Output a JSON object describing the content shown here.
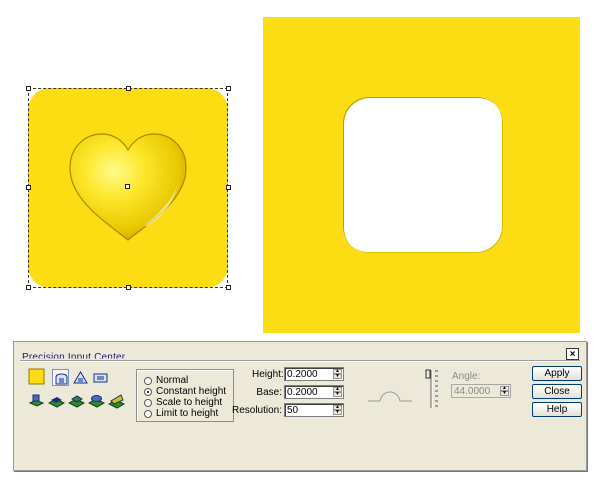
{
  "dialog": {
    "title": "Precision Input Center",
    "close_glyph": "×",
    "color_swatch": "#fcdc12",
    "modes": [
      {
        "label": "Normal",
        "selected": false
      },
      {
        "label": "Constant height",
        "selected": true
      },
      {
        "label": "Scale to height",
        "selected": false
      },
      {
        "label": "Limit to height",
        "selected": false
      }
    ],
    "height_label": "Height:",
    "height_value": "0.2000",
    "base_label": "Base:",
    "base_value": "0.2000",
    "resolution_label": "Resolution:",
    "resolution_value": "50",
    "angle_label": "Angle:",
    "angle_value": "44.0000",
    "buttons": {
      "apply": "Apply",
      "close": "Close",
      "help": "Help"
    },
    "icons": [
      "square-swatch-icon",
      "dome-shape-icon",
      "peak-shape-icon",
      "bevel-shape-icon",
      "layer-icon-1",
      "layer-icon-2",
      "layer-icon-3",
      "layer-icon-4",
      "layer-icon-5"
    ]
  },
  "canvas": {
    "object_color": "#fcdc12",
    "left_object": "rounded square with embossed heart, selected",
    "right_object": "square with rounded square cutout"
  }
}
